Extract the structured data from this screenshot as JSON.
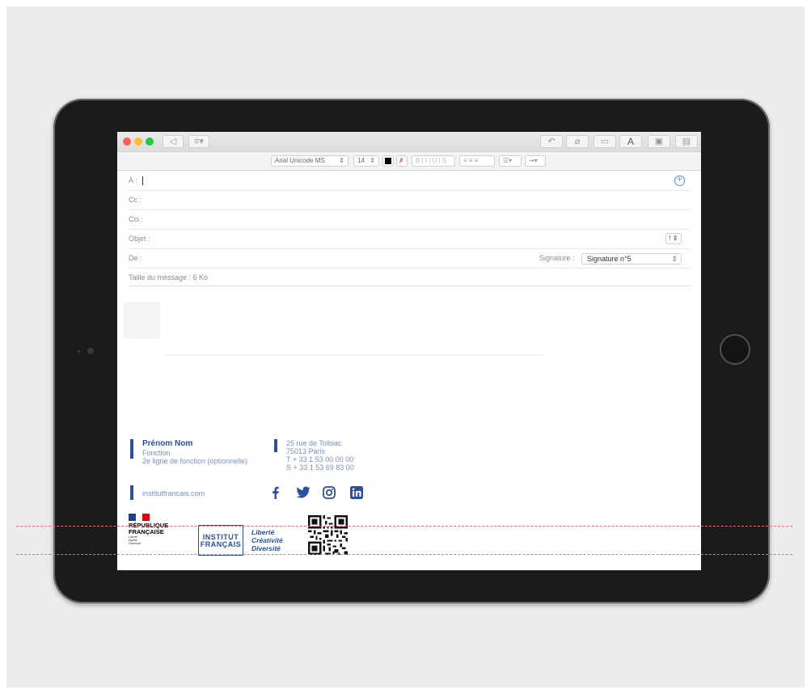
{
  "mail": {
    "format_bar": {
      "font_name": "Arial Unicode MS",
      "font_size": "14"
    },
    "fields": {
      "to_label": "À :",
      "cc_label": "Cc :",
      "bcc_label": "Cci :",
      "subject_label": "Objet :",
      "from_label": "De :",
      "signature_label": "Signature :",
      "signature_value": "Signature n°5",
      "message_size": "Taille du message : 6 Ko"
    }
  },
  "signature": {
    "name": "Prénom Nom",
    "function": "Fonction",
    "function_line2": "2e ligne de fonction (optionnelle)",
    "address_line1": "25 rue de Tolbiac",
    "address_line2": "75013 Paris",
    "phone": "T + 33 1 53 00 00 00",
    "standard": "S + 33 1 53 69 83 00",
    "website": "institutfrancais.com",
    "republique_line1": "RÉPUBLIQUE",
    "republique_line2": "FRANÇAISE",
    "devise": [
      "Liberté",
      "Égalité",
      "Fraternité"
    ],
    "institut_line1": "INSTITUT",
    "institut_line2": "FRANÇAIS",
    "slogan": [
      "Liberté",
      "Créativité",
      "Diversité"
    ],
    "social_icons": [
      "facebook-icon",
      "twitter-icon",
      "instagram-icon",
      "linkedin-icon"
    ]
  },
  "colors": {
    "brand_blue": "#2c4fa2",
    "guide_line": "#e57373"
  }
}
